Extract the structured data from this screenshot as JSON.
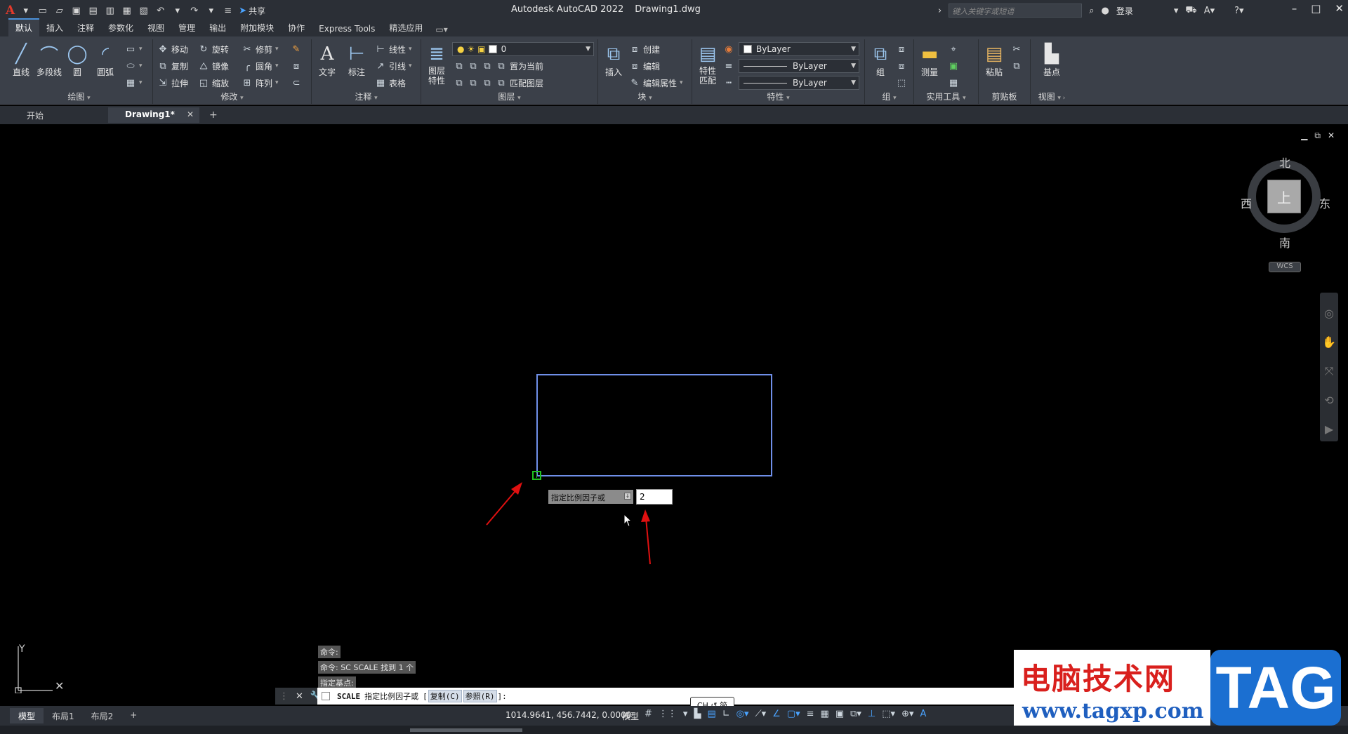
{
  "titlebar": {
    "app_letter": "A",
    "share_label": "共享",
    "app_title": "Autodesk AutoCAD 2022",
    "doc_title": "Drawing1.dwg",
    "search_placeholder": "键入关键字或短语",
    "login_label": "登录"
  },
  "ribbon_tabs": [
    "默认",
    "插入",
    "注释",
    "参数化",
    "视图",
    "管理",
    "输出",
    "附加模块",
    "协作",
    "Express Tools",
    "精选应用"
  ],
  "ribbon": {
    "draw": {
      "label": "绘图",
      "line": "直线",
      "polyline": "多段线",
      "circle": "圆",
      "arc": "圆弧"
    },
    "modify": {
      "label": "修改",
      "move": "移动",
      "rotate": "旋转",
      "trim": "修剪",
      "copy": "复制",
      "mirror": "镜像",
      "fillet": "圆角",
      "stretch": "拉伸",
      "scale": "缩放",
      "array": "阵列"
    },
    "annotation": {
      "label": "注释",
      "text": "文字",
      "dimension": "标注",
      "linear": "线性",
      "leader": "引线",
      "table": "表格"
    },
    "layers": {
      "label": "图层",
      "layer_props": "图层特性",
      "current_layer": "0",
      "set_current": "置为当前",
      "match_layer": "匹配图层"
    },
    "block": {
      "label": "块",
      "insert": "插入",
      "create": "创建",
      "edit": "编辑",
      "edit_attr": "编辑属性"
    },
    "properties": {
      "label": "特性",
      "match": "特性匹配",
      "color": "ByLayer",
      "linetype": "ByLayer",
      "lineweight": "ByLayer"
    },
    "groups": {
      "label": "组",
      "group": "组"
    },
    "utilities": {
      "label": "实用工具",
      "measure": "测量"
    },
    "clipboard": {
      "label": "剪贴板",
      "paste": "粘贴"
    },
    "view": {
      "label": "视图",
      "base": "基点"
    }
  },
  "file_tabs": [
    {
      "label": "开始"
    },
    {
      "label": "Drawing1*"
    }
  ],
  "viewcube": {
    "north": "北",
    "south": "南",
    "west": "西",
    "east": "东",
    "face": "上",
    "wcs": "WCS"
  },
  "dynamic_input": {
    "prompt": "指定比例因子或",
    "value": "2"
  },
  "cmd_history": [
    "命令:",
    "命令: SC SCALE 找到 1 个",
    "指定基点:"
  ],
  "cmdline": {
    "command": "SCALE",
    "prompt": "指定比例因子或",
    "bracket_open": "[",
    "opt_copy": "复制(C)",
    "opt_ref": "参照(R)",
    "bracket_close": "]:"
  },
  "ime": "CH ↺ 简",
  "status": {
    "layout_tabs": [
      "模型",
      "布局1",
      "布局2"
    ],
    "coords": "1014.9641, 456.7442, 0.0000",
    "model_label": "模型"
  },
  "watermark": {
    "site_name": "电脑技术网",
    "url": "www.tagxp.com",
    "tag": "TAG"
  },
  "colors": {
    "selection_blue": "#6f8fe8",
    "grip_green": "#20c020",
    "annotation_red": "#e01010",
    "ribbon_bg": "#3b4049",
    "titlebar_bg": "#2b2f36"
  }
}
